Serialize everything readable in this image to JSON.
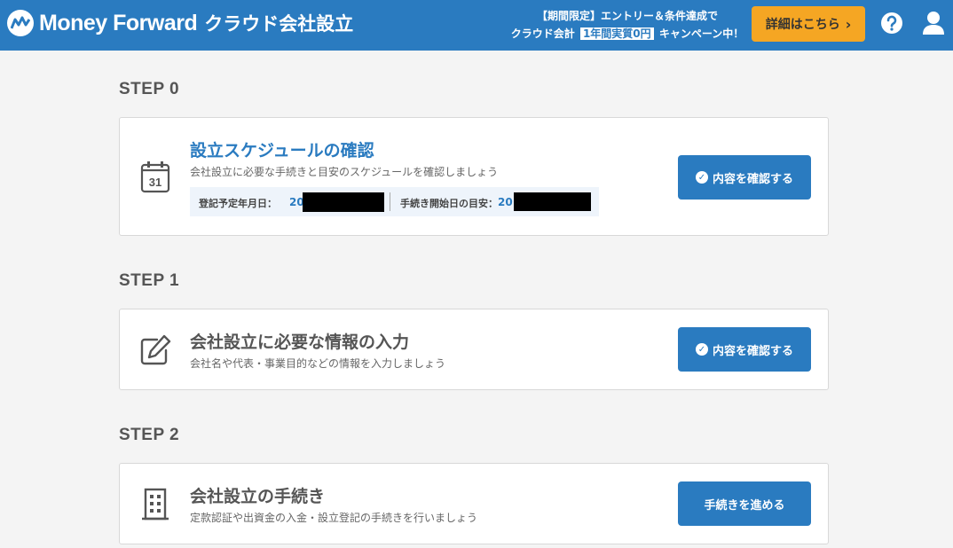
{
  "header": {
    "brand": "Money Forward",
    "product": "クラウド会社設立",
    "campaign": {
      "line1": "【期間限定】エントリー＆条件達成で",
      "line2_pre": "クラウド会計",
      "line2_badge": "1年間実質0円",
      "line2_post": "キャンペーン中！"
    },
    "detail_button": "詳細はこちら",
    "detail_chevron": "›",
    "help_icon": "question-circle-icon",
    "user_icon": "user-icon"
  },
  "steps": [
    {
      "step_label": "STEP 0",
      "heading": "設立スケジュールの確認",
      "heading_color": "#2a7bc0",
      "description": "会社設立に必要な手続きと目安のスケジュールを確認しましょう",
      "icon": "calendar-icon",
      "calendar_day": "31",
      "registration_label": "登記予定年月日：",
      "registration_value": "20",
      "start_label": "手続き開始日の目安：",
      "start_value": "20",
      "button": "内容を確認する",
      "button_check": "✓"
    },
    {
      "step_label": "STEP 1",
      "heading": "会社設立に必要な情報の入力",
      "heading_color": "#555555",
      "description": "会社名や代表・事業目的などの情報を入力しましょう",
      "icon": "edit-icon",
      "button": "内容を確認する",
      "button_check": "✓"
    },
    {
      "step_label": "STEP 2",
      "heading": "会社設立の手続き",
      "heading_color": "#555555",
      "description": "定款認証や出資金の入金・設立登記の手続きを行いましょう",
      "icon": "building-icon",
      "button": "手続きを進める"
    }
  ],
  "colors": {
    "brand_blue": "#2a7bc0",
    "accent_orange": "#f5a623"
  }
}
